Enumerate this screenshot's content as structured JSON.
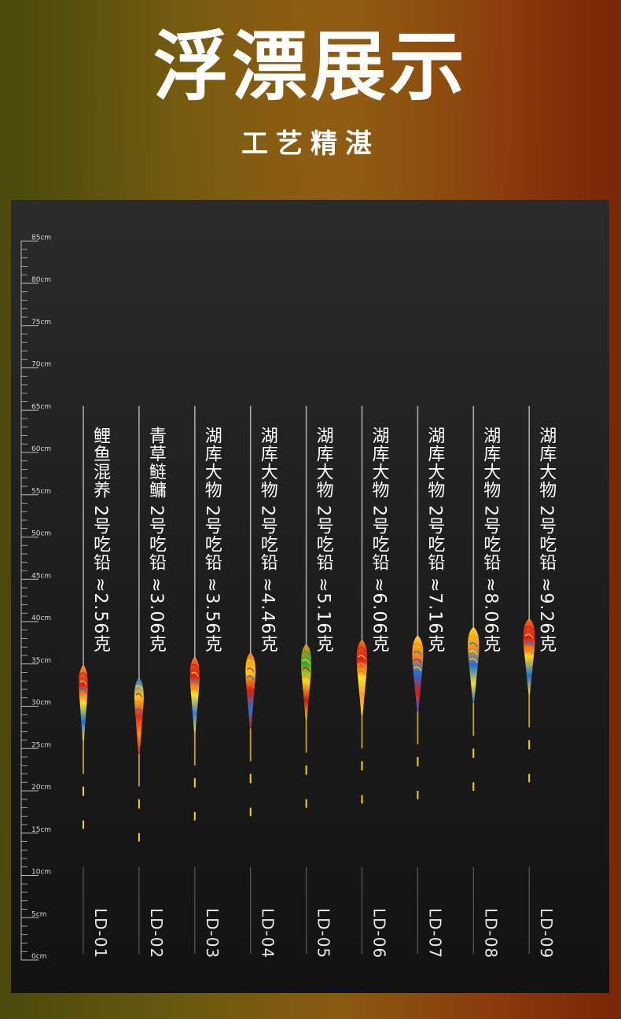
{
  "header": {
    "title": "浮漂展示",
    "subtitle": "工艺精湛"
  },
  "ruler": {
    "unit_labels": [
      "85cm",
      "80cm",
      "75cm",
      "70cm",
      "65cm",
      "60cm",
      "55cm",
      "50cm",
      "45cm",
      "40cm",
      "35cm",
      "30cm",
      "25cm",
      "20cm",
      "15cm",
      "10cm",
      "5cm",
      "0cm"
    ]
  },
  "floats": [
    {
      "model": "LD-01",
      "desc": "鲤鱼混养 2号吃铅 ≈2.56克",
      "length_cm": 34.5
    },
    {
      "model": "LD-02",
      "desc": "青草鲢鳙 2号吃铅 ≈3.06克",
      "length_cm": 33.0
    },
    {
      "model": "LD-03",
      "desc": "湖库大物 2号吃铅 ≈3.56克",
      "length_cm": 35.5
    },
    {
      "model": "LD-04",
      "desc": "湖库大物 2号吃铅 ≈4.46克",
      "length_cm": 36.0
    },
    {
      "model": "LD-05",
      "desc": "湖库大物 2号吃铅 ≈5.16克",
      "length_cm": 37.0
    },
    {
      "model": "LD-06",
      "desc": "湖库大物 2号吃铅 ≈6.06克",
      "length_cm": 37.5
    },
    {
      "model": "LD-07",
      "desc": "湖库大物 2号吃铅 ≈7.16克",
      "length_cm": 38.0
    },
    {
      "model": "LD-08",
      "desc": "湖库大物 2号吃铅 ≈8.06克",
      "length_cm": 39.0
    },
    {
      "model": "LD-09",
      "desc": "湖库大物 2号吃铅 ≈9.26克",
      "length_cm": 40.0
    }
  ],
  "colors": {
    "segment_red": "#ff2a1a",
    "segment_green": "#33ff33",
    "segment_yellow": "#ffd21a",
    "tube": "#c8c8c8"
  }
}
